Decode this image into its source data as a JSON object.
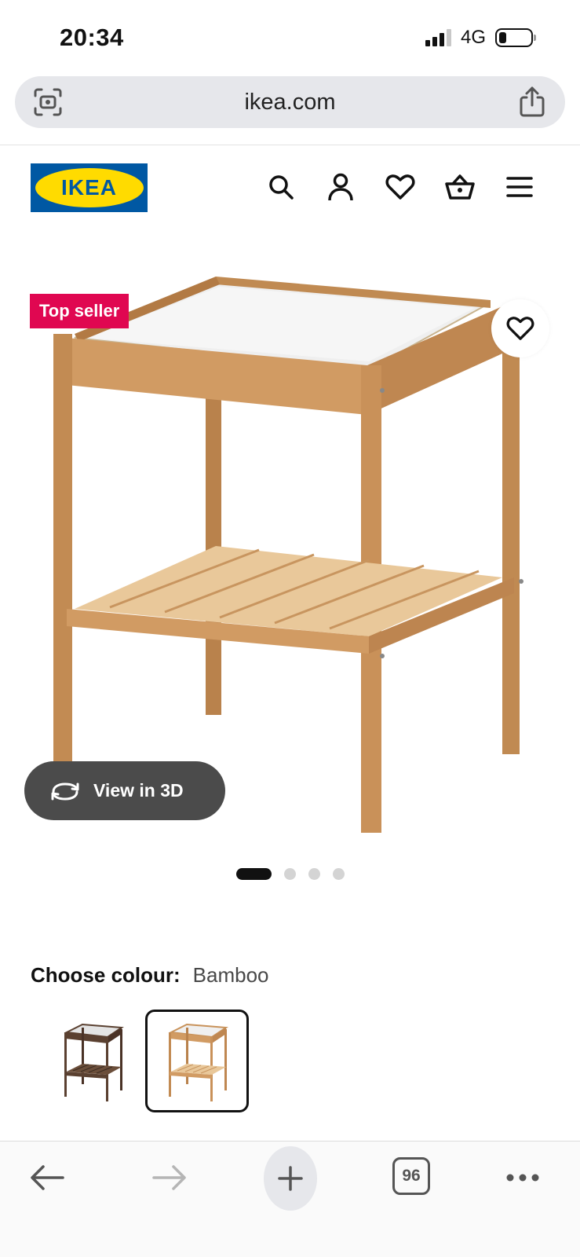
{
  "status_bar": {
    "time": "20:34",
    "network": "4G",
    "battery_level": 0.2
  },
  "browser": {
    "url": "ikea.com",
    "left_icon": "camera-scan-icon",
    "right_icon": "share-icon"
  },
  "header": {
    "logo_text": "IKEA",
    "icons": [
      "search-icon",
      "account-icon",
      "favourites-icon",
      "basket-icon",
      "menu-icon"
    ]
  },
  "product": {
    "badge": "Top seller",
    "view_3d_label": "View in 3D",
    "carousel": {
      "total": 4,
      "active_index": 0
    }
  },
  "colour": {
    "label": "Choose colour:",
    "selected": "Bamboo",
    "options": [
      {
        "swatch": "dark-brown",
        "selected": false
      },
      {
        "swatch": "bamboo",
        "selected": true
      }
    ]
  },
  "toolbar": {
    "tabs_count": "96",
    "icons": [
      "back-arrow-icon",
      "forward-arrow-icon",
      "new-tab-icon",
      "tabs-icon",
      "more-icon"
    ]
  },
  "colors": {
    "ikea_blue": "#0058a3",
    "ikea_yellow": "#ffdb00",
    "badge_red": "#e00751",
    "bamboo": "#c98e55"
  }
}
